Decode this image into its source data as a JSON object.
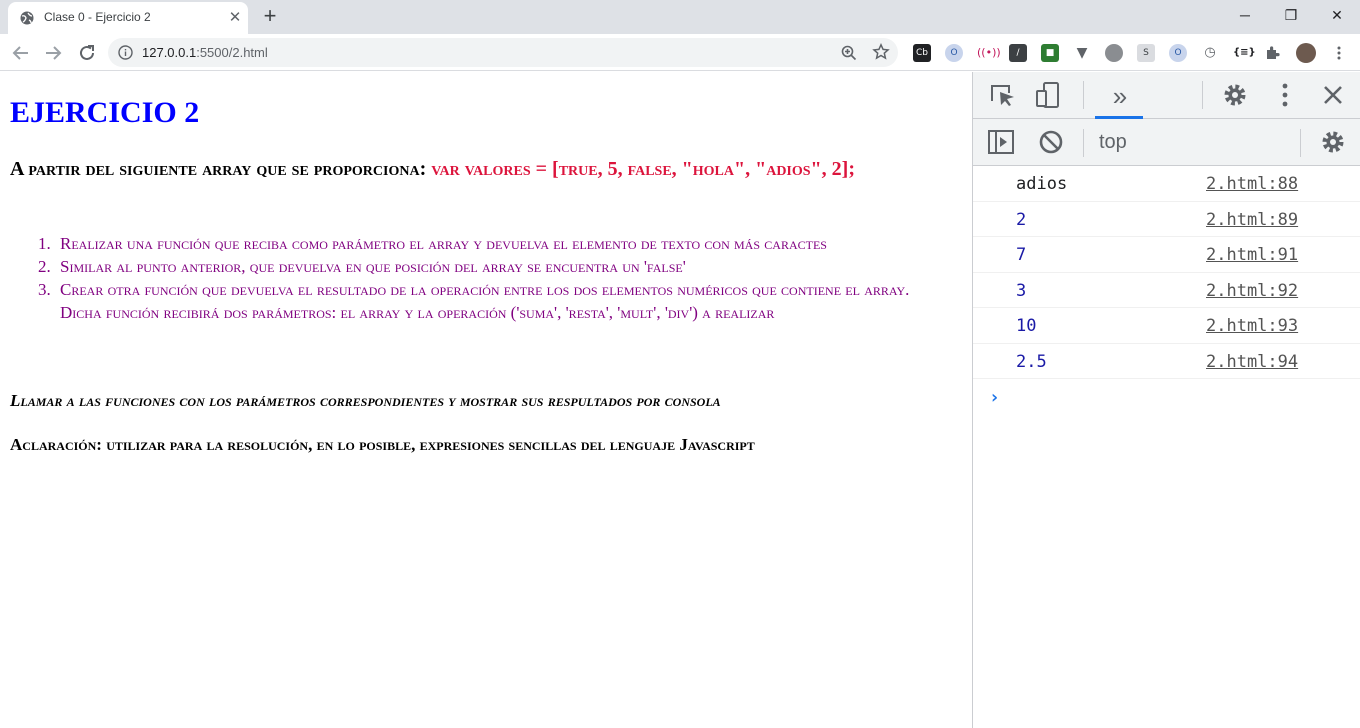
{
  "tab": {
    "title": "Clase 0 - Ejercicio 2",
    "close": "✕",
    "new_tab": "+"
  },
  "window_controls": {
    "minimize": "─",
    "restore": "❐",
    "close": "✕"
  },
  "address_bar": {
    "url_host": "127.0.0.1",
    "url_rest": ":5500/2.html"
  },
  "extensions": [
    "cb-icon",
    "opera-icon",
    "broadcast-icon",
    "dropper-icon",
    "evernote-icon",
    "vue-icon",
    "balloon-icon",
    "s-icon",
    "opera-icon-2",
    "timer-icon",
    "json-icon",
    "puzzle-icon",
    "avatar",
    "menu-icon"
  ],
  "page": {
    "heading": "EJERCICIO 2",
    "intro_text": "A partir del siguiente array que se proporciona: ",
    "intro_code": "var valores = [true, 5, false, \"hola\", \"adios\", 2];",
    "tasks": [
      {
        "num": "1.",
        "text": "Realizar una función que reciba como parámetro el array y devuelva el elemento de texto con más caractes"
      },
      {
        "num": "2.",
        "text": "Similar al punto anterior, que devuelva en que posición del array se encuentra un 'false'"
      },
      {
        "num": "3.",
        "text": "Crear otra función que devuelva el resultado de la operación entre los dos elementos numéricos que contiene el array.",
        "extra": "Dicha función recibirá dos parámetros: el array y la operación ('suma', 'resta', 'mult', 'div') a realizar"
      }
    ],
    "call_note": "Llamar a las funciones con los parámetros correspondientes y mostrar sus respultados por consola",
    "clarify_note": "Aclaración: utilizar para la resolución, en lo posible, expresiones sencillas del lenguaje Javascript"
  },
  "devtools": {
    "more_tabs": "»",
    "context": "top",
    "logs": [
      {
        "value": "adios",
        "type": "str",
        "source": "2.html:88"
      },
      {
        "value": "2",
        "type": "num",
        "source": "2.html:89"
      },
      {
        "value": "7",
        "type": "num",
        "source": "2.html:91"
      },
      {
        "value": "3",
        "type": "num",
        "source": "2.html:92"
      },
      {
        "value": "10",
        "type": "num",
        "source": "2.html:93"
      },
      {
        "value": "2.5",
        "type": "num",
        "source": "2.html:94"
      }
    ],
    "prompt": "›"
  },
  "colors": {
    "heading": "#0000ff",
    "code": "#dc143c",
    "tasks": "#800080",
    "console_number": "#1a1aa6",
    "accent": "#1a73e8"
  }
}
